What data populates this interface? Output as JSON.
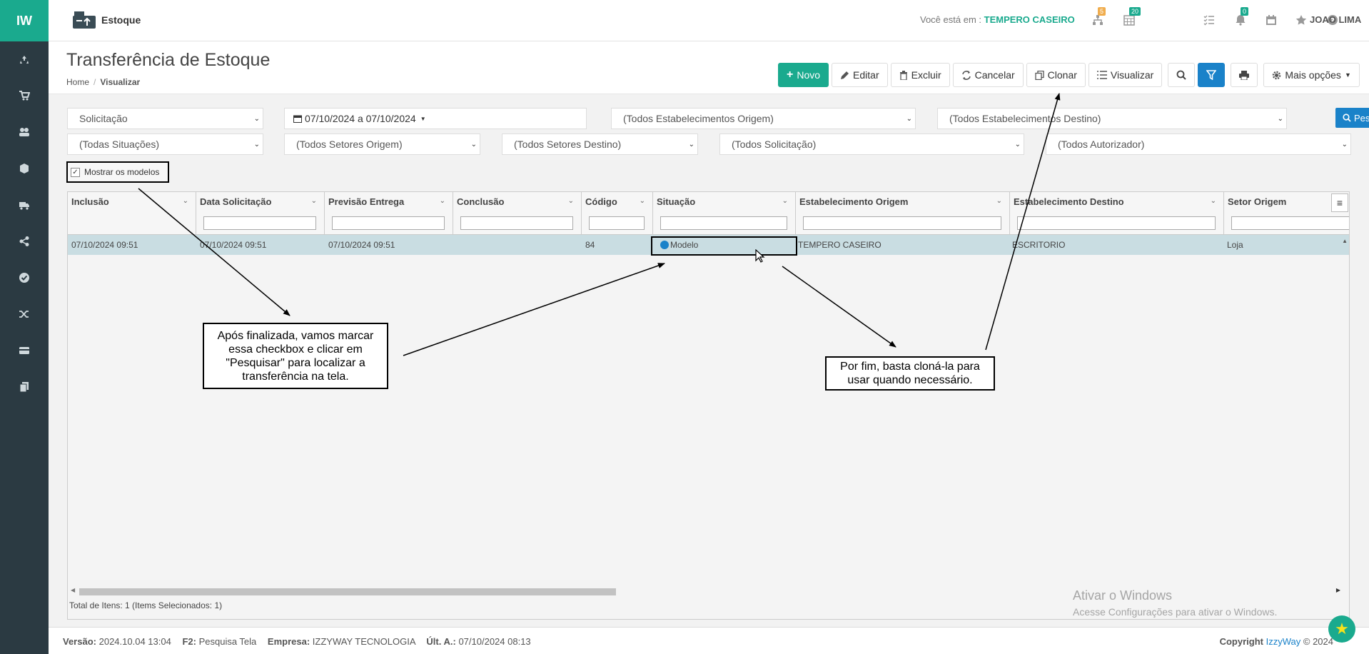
{
  "sidebar": {
    "logo": "IW",
    "icons": [
      "recycle-icon",
      "cart-icon",
      "users-icon",
      "box-icon",
      "truck-icon",
      "share-icon",
      "check-circle-icon",
      "shuffle-icon",
      "card-icon",
      "copy-icon"
    ]
  },
  "topbar": {
    "module": "Estoque",
    "location_prefix": "Você está em :",
    "location": "TEMPERO CASEIRO",
    "badges": {
      "org": "5",
      "calendar": "20",
      "bell": "0"
    },
    "user": "JOAO LIMA"
  },
  "header": {
    "title": "Transferência de Estoque",
    "breadcrumb_home": "Home",
    "breadcrumb_sep": "/",
    "breadcrumb_current": "Visualizar"
  },
  "actions": {
    "novo": "Novo",
    "editar": "Editar",
    "excluir": "Excluir",
    "cancelar": "Cancelar",
    "clonar": "Clonar",
    "visualizar": "Visualizar",
    "mais": "Mais opções"
  },
  "filters": {
    "tipo": "Solicitação",
    "date_range": "07/10/2024 a 07/10/2024",
    "estab_origem": "(Todos Estabelecimentos Origem)",
    "estab_destino": "(Todos Estabelecimentos Destino)",
    "situacoes": "(Todas Situações)",
    "setores_origem": "(Todos Setores Origem)",
    "setores_destino": "(Todos Setores Destino)",
    "solicitacao": "(Todos Solicitação)",
    "autorizador": "(Todos Autorizador)",
    "pesquisar": "Pesquisar",
    "mostrar_modelos": "Mostrar os modelos"
  },
  "grid": {
    "columns": [
      "Inclusão",
      "Data Solicitação",
      "Previsão Entrega",
      "Conclusão",
      "Código",
      "Situação",
      "Estabelecimento Origem",
      "Estabelecimento Destino",
      "Setor Origem"
    ],
    "row": {
      "inclusao": "07/10/2024 09:51",
      "data_solicitacao": "07/10/2024 09:51",
      "previsao": "07/10/2024 09:51",
      "conclusao": "",
      "codigo": "84",
      "situacao": "Modelo",
      "origem": "TEMPERO CASEIRO",
      "destino": "ESCRITORIO",
      "setor_origem": "Loja"
    },
    "total": "Total de Itens: 1 (Items Selecionados: 1)"
  },
  "callouts": {
    "left": "Após finalizada, vamos marcar essa checkbox e clicar em \"Pesquisar\" para localizar a transferência na tela.",
    "right": "Por fim, basta cloná-la para usar quando necessário."
  },
  "watermark": {
    "line1": "Ativar o Windows",
    "line2": "Acesse Configurações para ativar o Windows."
  },
  "footer": {
    "versao_label": "Versão:",
    "versao": "2024.10.04 13:04",
    "f2_label": "F2:",
    "f2": "Pesquisa Tela",
    "empresa_label": "Empresa:",
    "empresa": "IZZYWAY TECNOLOGIA",
    "ult_label": "Últ. A.:",
    "ult": "07/10/2024 08:13",
    "copyright_label": "Copyright",
    "copyright_brand": "IzzyWay",
    "copyright_year": "© 2024"
  },
  "colors": {
    "brand": "#1aaa8e",
    "primary": "#1a82c9",
    "sidebar": "#2b3a42"
  }
}
